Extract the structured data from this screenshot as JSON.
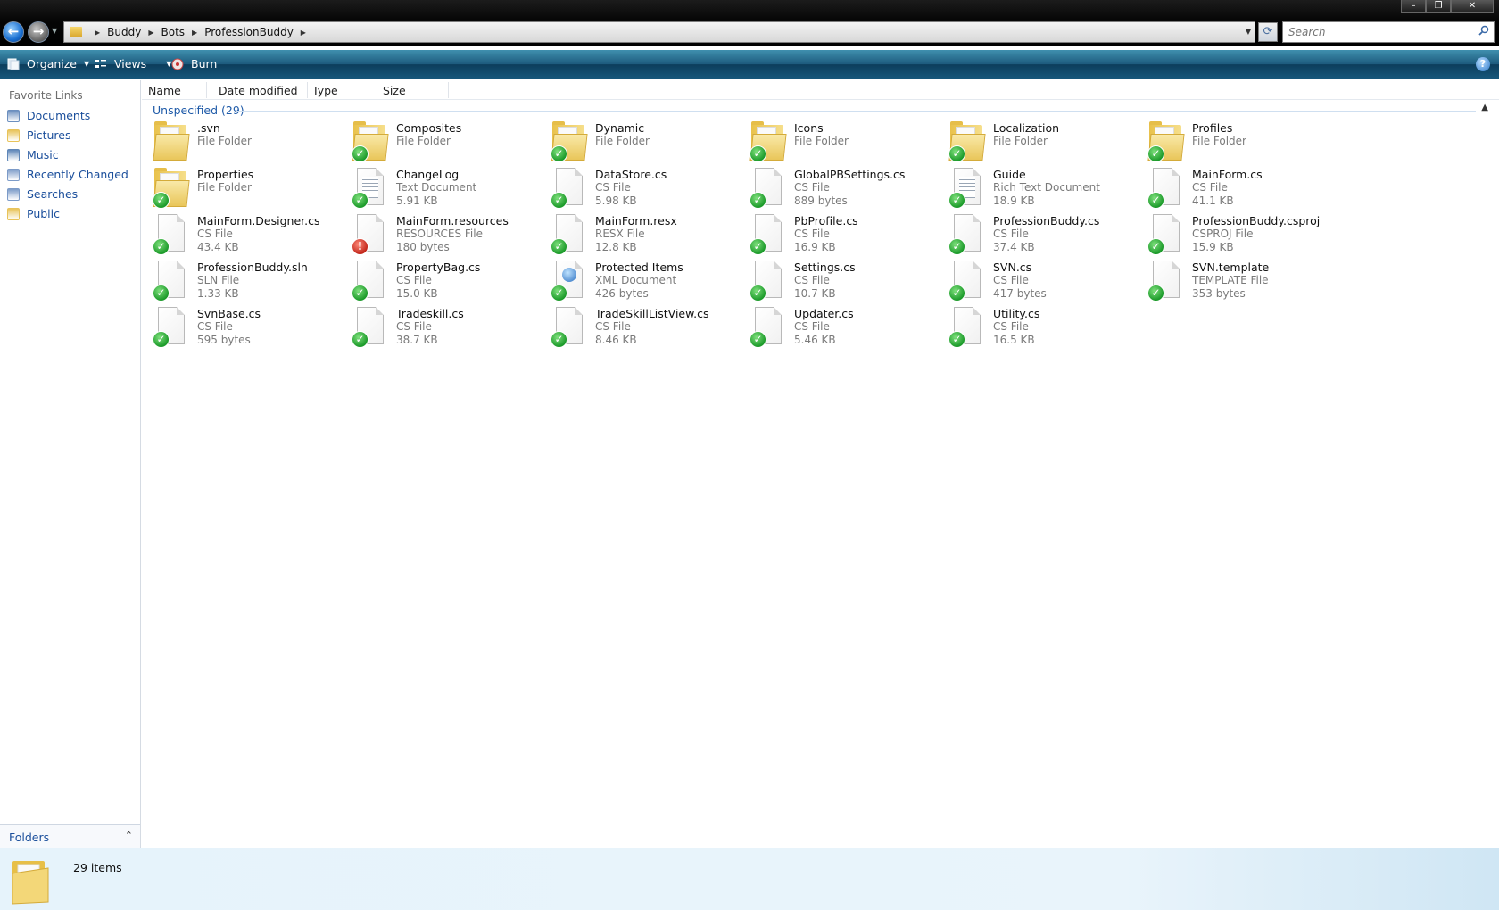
{
  "window": {
    "minimize_glyph": "–",
    "maximize_glyph": "❐",
    "close_glyph": "✕"
  },
  "nav": {
    "back_glyph": "←",
    "forward_glyph": "→"
  },
  "address": {
    "breadcrumbs": [
      "Buddy",
      "Bots",
      "ProfessionBuddy"
    ]
  },
  "search": {
    "placeholder": "Search"
  },
  "toolbar": {
    "organize": "Organize",
    "views": "Views",
    "burn": "Burn"
  },
  "sidebar": {
    "header": "Favorite Links",
    "items": [
      {
        "label": "Documents",
        "icon": "documents-icon",
        "color": "#6c8fbf"
      },
      {
        "label": "Pictures",
        "icon": "pictures-icon",
        "color": "#e8c35a"
      },
      {
        "label": "Music",
        "icon": "music-icon",
        "color": "#5e86b8"
      },
      {
        "label": "Recently Changed",
        "icon": "recent-icon",
        "color": "#7c9bc8"
      },
      {
        "label": "Searches",
        "icon": "searches-icon",
        "color": "#7c9bc8"
      },
      {
        "label": "Public",
        "icon": "public-folder-icon",
        "color": "#e8c35a"
      }
    ],
    "folders_label": "Folders"
  },
  "columns": [
    "Name",
    "Date modified",
    "Type",
    "Size"
  ],
  "group": {
    "label": "Unspecified (29)"
  },
  "items": [
    {
      "name": ".svn",
      "type": "File Folder",
      "size": "",
      "kind": "folder",
      "status": "none"
    },
    {
      "name": "Composites",
      "type": "File Folder",
      "size": "",
      "kind": "folder",
      "status": "ok"
    },
    {
      "name": "Dynamic",
      "type": "File Folder",
      "size": "",
      "kind": "folder",
      "status": "ok"
    },
    {
      "name": "Icons",
      "type": "File Folder",
      "size": "",
      "kind": "folder",
      "status": "ok"
    },
    {
      "name": "Localization",
      "type": "File Folder",
      "size": "",
      "kind": "folder",
      "status": "ok"
    },
    {
      "name": "Profiles",
      "type": "File Folder",
      "size": "",
      "kind": "folder",
      "status": "ok"
    },
    {
      "name": "Properties",
      "type": "File Folder",
      "size": "",
      "kind": "folder",
      "status": "ok"
    },
    {
      "name": "ChangeLog",
      "type": "Text Document",
      "size": "5.91 KB",
      "kind": "text",
      "status": "ok"
    },
    {
      "name": "DataStore.cs",
      "type": "CS File",
      "size": "5.98 KB",
      "kind": "file",
      "status": "ok"
    },
    {
      "name": "GlobalPBSettings.cs",
      "type": "CS File",
      "size": "889 bytes",
      "kind": "file",
      "status": "ok"
    },
    {
      "name": "Guide",
      "type": "Rich Text Document",
      "size": "18.9 KB",
      "kind": "rtf",
      "status": "ok"
    },
    {
      "name": "MainForm.cs",
      "type": "CS File",
      "size": "41.1 KB",
      "kind": "file",
      "status": "ok"
    },
    {
      "name": "MainForm.Designer.cs",
      "type": "CS File",
      "size": "43.4 KB",
      "kind": "file",
      "status": "ok"
    },
    {
      "name": "MainForm.resources",
      "type": "RESOURCES File",
      "size": "180 bytes",
      "kind": "file",
      "status": "conflict"
    },
    {
      "name": "MainForm.resx",
      "type": "RESX File",
      "size": "12.8 KB",
      "kind": "file",
      "status": "ok"
    },
    {
      "name": "PbProfile.cs",
      "type": "CS File",
      "size": "16.9 KB",
      "kind": "file",
      "status": "ok"
    },
    {
      "name": "ProfessionBuddy.cs",
      "type": "CS File",
      "size": "37.4 KB",
      "kind": "file",
      "status": "ok"
    },
    {
      "name": "ProfessionBuddy.csproj",
      "type": "CSPROJ File",
      "size": "15.9 KB",
      "kind": "file",
      "status": "ok"
    },
    {
      "name": "ProfessionBuddy.sln",
      "type": "SLN File",
      "size": "1.33 KB",
      "kind": "file",
      "status": "ok"
    },
    {
      "name": "PropertyBag.cs",
      "type": "CS File",
      "size": "15.0 KB",
      "kind": "file",
      "status": "ok"
    },
    {
      "name": "Protected Items",
      "type": "XML Document",
      "size": "426 bytes",
      "kind": "xml",
      "status": "ok"
    },
    {
      "name": "Settings.cs",
      "type": "CS File",
      "size": "10.7 KB",
      "kind": "file",
      "status": "ok"
    },
    {
      "name": "SVN.cs",
      "type": "CS File",
      "size": "417 bytes",
      "kind": "file",
      "status": "ok"
    },
    {
      "name": "SVN.template",
      "type": "TEMPLATE File",
      "size": "353 bytes",
      "kind": "file",
      "status": "ok"
    },
    {
      "name": "SvnBase.cs",
      "type": "CS File",
      "size": "595 bytes",
      "kind": "file",
      "status": "ok"
    },
    {
      "name": "Tradeskill.cs",
      "type": "CS File",
      "size": "38.7 KB",
      "kind": "file",
      "status": "ok"
    },
    {
      "name": "TradeSkillListView.cs",
      "type": "CS File",
      "size": "8.46 KB",
      "kind": "file",
      "status": "ok"
    },
    {
      "name": "Updater.cs",
      "type": "CS File",
      "size": "5.46 KB",
      "kind": "file",
      "status": "ok"
    },
    {
      "name": "Utility.cs",
      "type": "CS File",
      "size": "16.5 KB",
      "kind": "file",
      "status": "ok"
    }
  ],
  "status": {
    "item_count": "29 items"
  }
}
